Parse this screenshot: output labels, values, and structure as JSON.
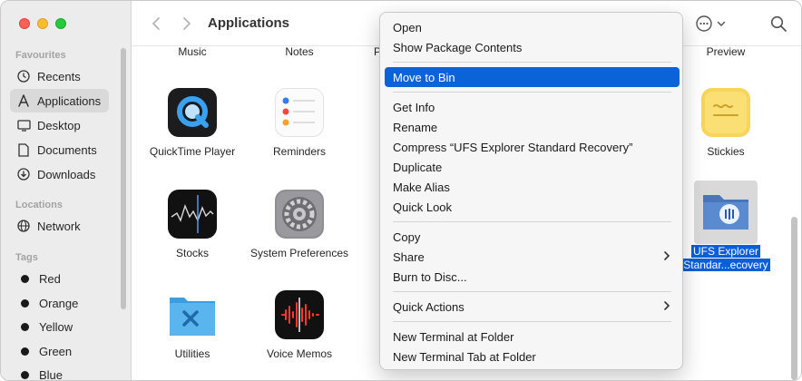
{
  "window": {
    "title": "Applications"
  },
  "sidebar": {
    "favourites_header": "Favourites",
    "favourites": [
      {
        "label": "Recents",
        "icon": "clock-icon"
      },
      {
        "label": "Applications",
        "icon": "applications-icon",
        "active": true
      },
      {
        "label": "Desktop",
        "icon": "desktop-icon"
      },
      {
        "label": "Documents",
        "icon": "document-icon"
      },
      {
        "label": "Downloads",
        "icon": "download-icon"
      }
    ],
    "locations_header": "Locations",
    "locations": [
      {
        "label": "Network",
        "icon": "globe-icon"
      }
    ],
    "tags_header": "Tags",
    "tags": [
      {
        "label": "Red"
      },
      {
        "label": "Orange"
      },
      {
        "label": "Yellow"
      },
      {
        "label": "Green"
      },
      {
        "label": "Blue"
      }
    ]
  },
  "content": {
    "top_labels": {
      "music": "Music",
      "notes": "Notes",
      "partial": "P",
      "preview": "Preview"
    },
    "apps": {
      "quicktime": {
        "label": "QuickTime Player"
      },
      "reminders": {
        "label": "Reminders"
      },
      "stickies": {
        "label": "Stickies"
      },
      "stocks": {
        "label": "Stocks"
      },
      "system_prefs": {
        "label": "System Preferences"
      },
      "ufs": {
        "label_line1": "UFS Explorer",
        "label_line2": "Standar...ecovery"
      },
      "utilities": {
        "label": "Utilities"
      },
      "voice_memos": {
        "label": "Voice Memos"
      }
    }
  },
  "context_menu": {
    "items": [
      {
        "id": "open",
        "label": "Open"
      },
      {
        "id": "show_package",
        "label": "Show Package Contents"
      },
      {
        "id": "move_to_bin",
        "label": "Move to Bin",
        "highlighted": true
      },
      {
        "id": "get_info",
        "label": "Get Info"
      },
      {
        "id": "rename",
        "label": "Rename"
      },
      {
        "id": "compress",
        "label": "Compress “UFS Explorer Standard Recovery”"
      },
      {
        "id": "duplicate",
        "label": "Duplicate"
      },
      {
        "id": "make_alias",
        "label": "Make Alias"
      },
      {
        "id": "quick_look",
        "label": "Quick Look"
      },
      {
        "id": "copy",
        "label": "Copy"
      },
      {
        "id": "share",
        "label": "Share",
        "submenu": true
      },
      {
        "id": "burn",
        "label": "Burn to Disc..."
      },
      {
        "id": "quick_actions",
        "label": "Quick Actions",
        "submenu": true
      },
      {
        "id": "new_terminal",
        "label": "New Terminal at Folder"
      },
      {
        "id": "new_terminal_tab",
        "label": "New Terminal Tab at Folder"
      }
    ]
  },
  "colors": {
    "highlight": "#0a64d8",
    "selection": "#0a5fd6"
  }
}
